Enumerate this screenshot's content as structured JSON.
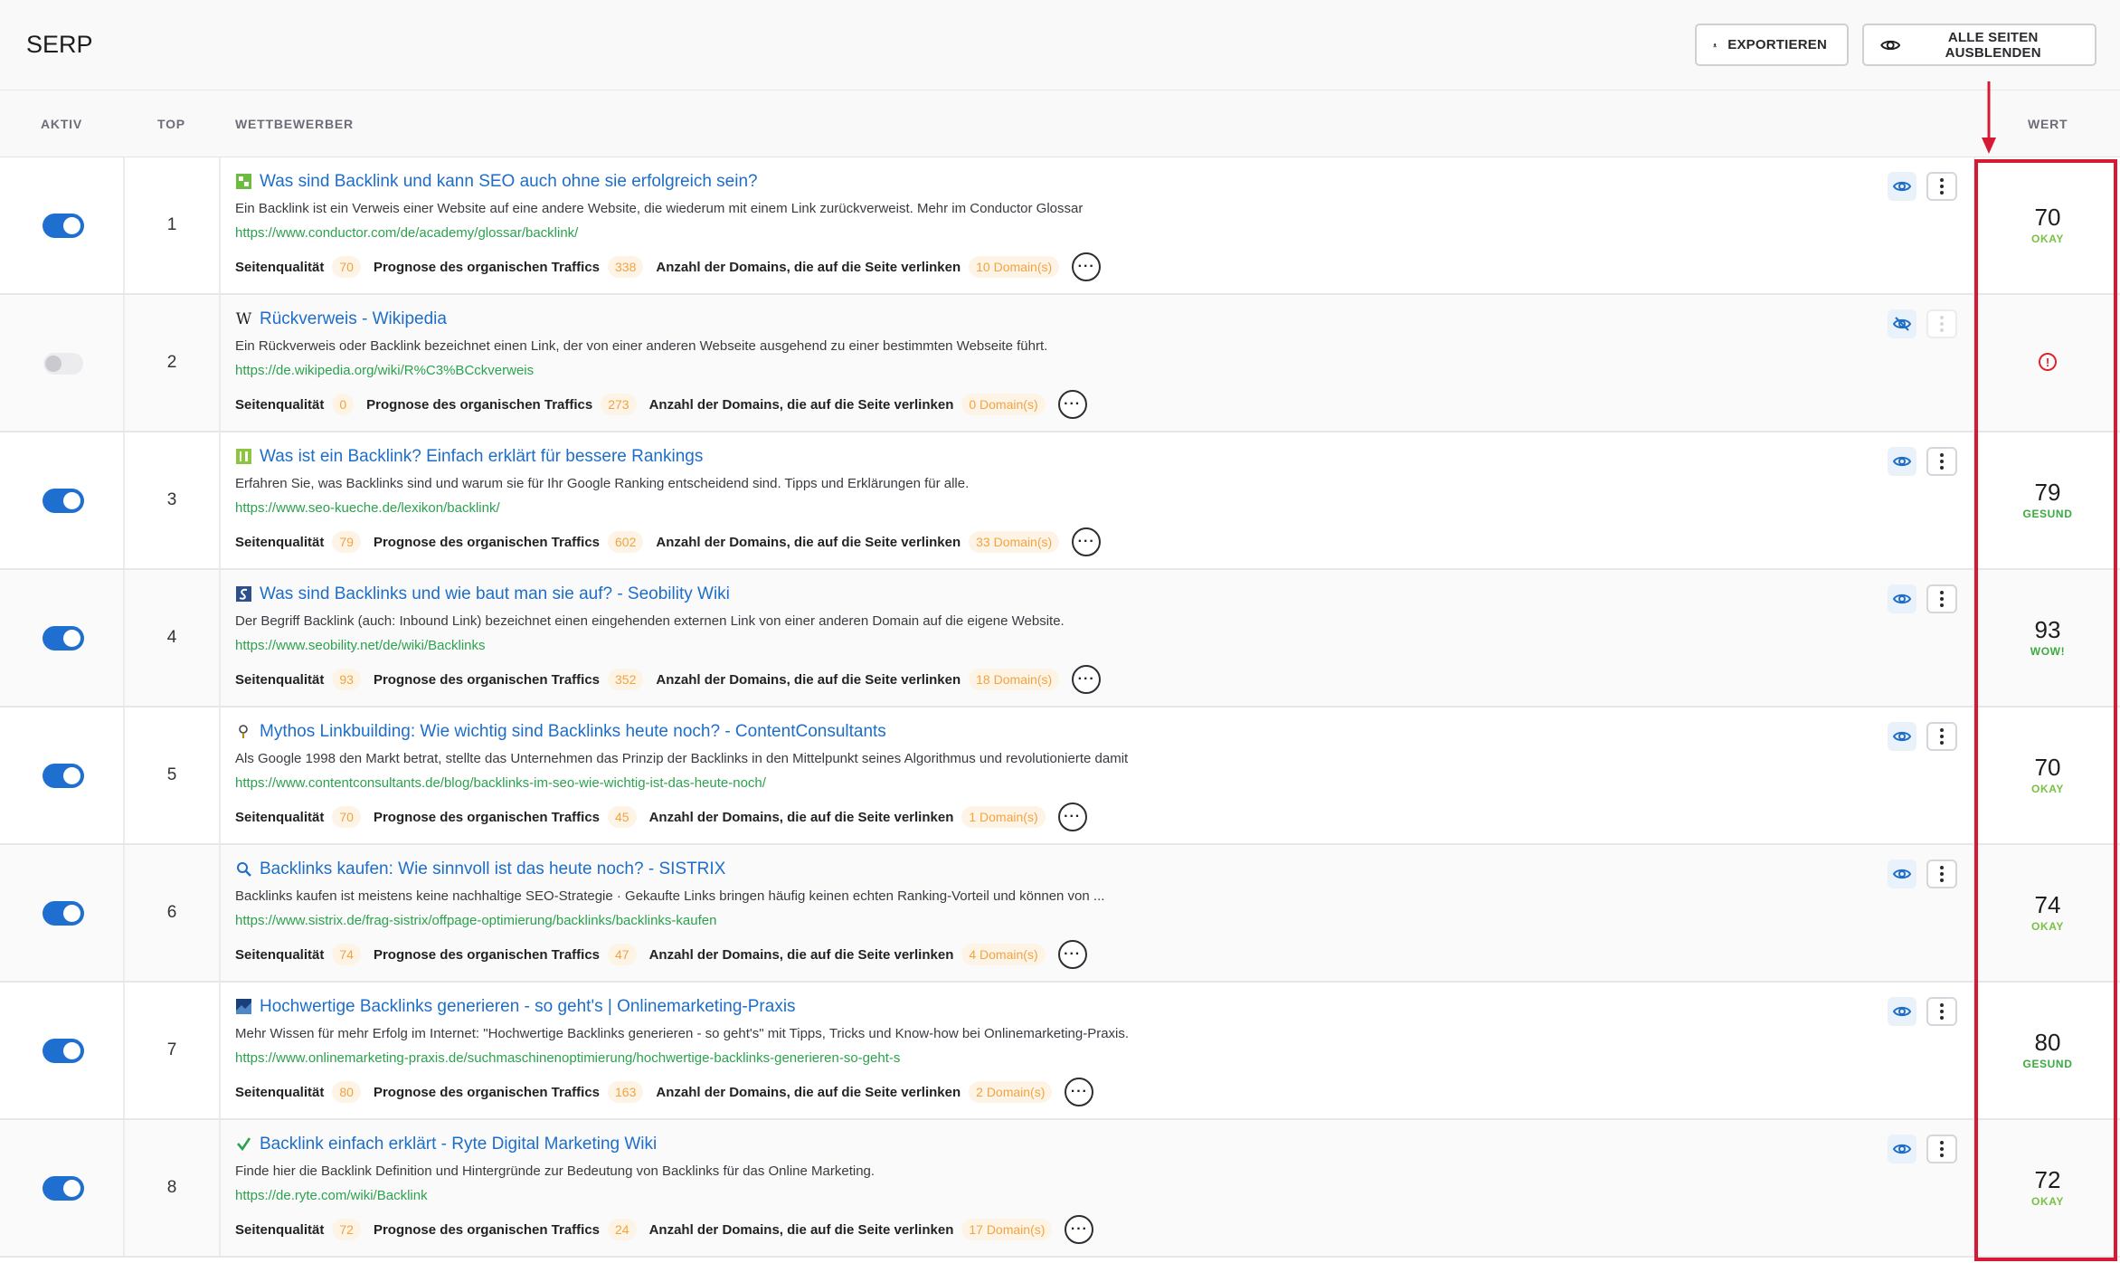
{
  "page": {
    "title": "SERP"
  },
  "toolbar": {
    "export_label": "EXPORTIEREN",
    "hide_all_label": "ALLE SEITEN AUSBLENDEN"
  },
  "columns": {
    "aktiv": "AKTIV",
    "top": "TOP",
    "wettbewerber": "WETTBEWERBER",
    "wert": "WERT"
  },
  "metric_labels": {
    "quality": "Seitenqualität",
    "traffic": "Prognose des organischen Traffics",
    "domains": "Anzahl der Domains, die auf die Seite verlinken"
  },
  "rows": [
    {
      "active": true,
      "rank": "1",
      "favicon": "conductor-icon",
      "title": "Was sind Backlink und kann SEO auch ohne sie erfolgreich sein?",
      "description": "Ein Backlink ist ein Verweis einer Website auf eine andere Website, die wiederum mit einem Link zurückverweist. Mehr im Conductor Glossar",
      "url": "https://www.conductor.com/de/academy/glossar/backlink/",
      "quality": "70",
      "traffic": "338",
      "domains": "10 Domain(s)",
      "visible": true,
      "score": "70",
      "score_label": "OKAY"
    },
    {
      "active": false,
      "rank": "2",
      "favicon": "wikipedia-icon",
      "title": "Rückverweis - Wikipedia",
      "description": "Ein Rückverweis oder Backlink bezeichnet einen Link, der von einer anderen Webseite ausgehend zu einer bestimmten Webseite führt.",
      "url": "https://de.wikipedia.org/wiki/R%C3%BCckverweis",
      "quality": "0",
      "traffic": "273",
      "domains": "0 Domain(s)",
      "visible": false,
      "score": "",
      "score_label": "",
      "score_alert": "!"
    },
    {
      "active": true,
      "rank": "3",
      "favicon": "seo-kueche-icon",
      "title": "Was ist ein Backlink? Einfach erklärt für bessere Rankings",
      "description": "Erfahren Sie, was Backlinks sind und warum sie für Ihr Google Ranking entscheidend sind. Tipps und Erklärungen für alle.",
      "url": "https://www.seo-kueche.de/lexikon/backlink/",
      "quality": "79",
      "traffic": "602",
      "domains": "33 Domain(s)",
      "visible": true,
      "score": "79",
      "score_label": "GESUND"
    },
    {
      "active": true,
      "rank": "4",
      "favicon": "seobility-icon",
      "title": "Was sind Backlinks und wie baut man sie auf? - Seobility Wiki",
      "description": "Der Begriff Backlink (auch: Inbound Link) bezeichnet einen eingehenden externen Link von einer anderen Domain auf die eigene Website.",
      "url": "https://www.seobility.net/de/wiki/Backlinks",
      "quality": "93",
      "traffic": "352",
      "domains": "18 Domain(s)",
      "visible": true,
      "score": "93",
      "score_label": "WOW!"
    },
    {
      "active": true,
      "rank": "5",
      "favicon": "contentconsultants-icon",
      "title": "Mythos Linkbuilding: Wie wichtig sind Backlinks heute noch? - ContentConsultants",
      "description": "Als Google 1998 den Markt betrat, stellte das Unternehmen das Prinzip der Backlinks in den Mittelpunkt seines Algorithmus und revolutionierte damit",
      "url": "https://www.contentconsultants.de/blog/backlinks-im-seo-wie-wichtig-ist-das-heute-noch/",
      "quality": "70",
      "traffic": "45",
      "domains": "1 Domain(s)",
      "visible": true,
      "score": "70",
      "score_label": "OKAY"
    },
    {
      "active": true,
      "rank": "6",
      "favicon": "sistrix-icon",
      "title": "Backlinks kaufen: Wie sinnvoll ist das heute noch? - SISTRIX",
      "description": "Backlinks kaufen ist meistens keine nachhaltige SEO-Strategie · Gekaufte Links bringen häufig keinen echten Ranking-Vorteil und können von ...",
      "url": "https://www.sistrix.de/frag-sistrix/offpage-optimierung/backlinks/backlinks-kaufen",
      "quality": "74",
      "traffic": "47",
      "domains": "4 Domain(s)",
      "visible": true,
      "score": "74",
      "score_label": "OKAY"
    },
    {
      "active": true,
      "rank": "7",
      "favicon": "onlinemarketing-praxis-icon",
      "title": "Hochwertige Backlinks generieren - so geht's | Onlinemarketing-Praxis",
      "description": "Mehr Wissen für mehr Erfolg im Internet: \"Hochwertige Backlinks generieren - so geht's\" mit Tipps, Tricks und Know-how bei Onlinemarketing-Praxis.",
      "url": "https://www.onlinemarketing-praxis.de/suchmaschinenoptimierung/hochwertige-backlinks-generieren-so-geht-s",
      "quality": "80",
      "traffic": "163",
      "domains": "2 Domain(s)",
      "visible": true,
      "score": "80",
      "score_label": "GESUND"
    },
    {
      "active": true,
      "rank": "8",
      "favicon": "ryte-icon",
      "title": "Backlink einfach erklärt - Ryte Digital Marketing Wiki",
      "description": "Finde hier die Backlink Definition und Hintergründe zur Bedeutung von Backlinks für das Online Marketing.",
      "url": "https://de.ryte.com/wiki/Backlink",
      "quality": "72",
      "traffic": "24",
      "domains": "17 Domain(s)",
      "visible": true,
      "score": "72",
      "score_label": "OKAY"
    }
  ],
  "colors": {
    "accent": "#1f6fd1",
    "link": "#1e6ec8",
    "url": "#2ca24c",
    "badge_text": "#f2a341",
    "highlight": "#d61a34"
  }
}
